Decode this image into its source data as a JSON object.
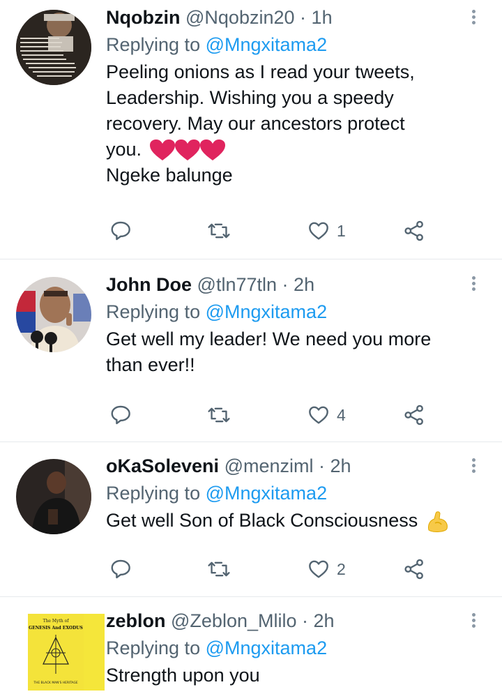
{
  "tweets": [
    {
      "name": "Nqobzin",
      "handle": "@Nqobzin20",
      "dot": "·",
      "time": "1h",
      "replying_prefix": "Replying to",
      "replying_to": "@Mngxitama2",
      "text_lines": [
        "Peeling onions as I read your tweets,",
        "Leadership. Wishing you a speedy",
        "recovery. May our ancestors protect",
        "you."
      ],
      "extra_line": "Ngeke balunge",
      "emojis": [
        "red-heart",
        "red-heart",
        "red-heart"
      ],
      "like_count": "1",
      "avatar": "text-poster-avatar"
    },
    {
      "name": "John Doe",
      "handle": "@tln77tln",
      "dot": "·",
      "time": "2h",
      "replying_prefix": "Replying to",
      "replying_to": "@Mngxitama2",
      "text_lines": [
        "Get well my leader! We need you more",
        "than ever!!"
      ],
      "like_count": "4",
      "avatar": "man-with-microphones-avatar"
    },
    {
      "name": "oKaSoleveni",
      "handle": "@menziml",
      "dot": "·",
      "time": "2h",
      "replying_prefix": "Replying to",
      "replying_to": "@Mngxitama2",
      "text_lines": [
        "Get well Son of Black Consciousness"
      ],
      "emojis": [
        "flexed-biceps"
      ],
      "like_count": "2",
      "avatar": "seated-man-avatar"
    },
    {
      "name": "zeblon",
      "handle": "@Zeblon_Mlilo",
      "dot": "·",
      "time": "2h",
      "replying_prefix": "Replying to",
      "replying_to": "@Mngxitama2",
      "text_lines": [
        "Strength upon you"
      ],
      "avatar": "yellow-book-cover-avatar",
      "avatar_text": {
        "title_top": "The Myth of",
        "title_main": "GENESIS And EXODUS",
        "footer": "THE BLACK MAN'S HERITAGE"
      }
    }
  ],
  "colors": {
    "text": "#0f1419",
    "secondary": "#536471",
    "link": "#1d9bf0",
    "divider": "#e6e9ec",
    "heart_red": "#e0245e"
  }
}
